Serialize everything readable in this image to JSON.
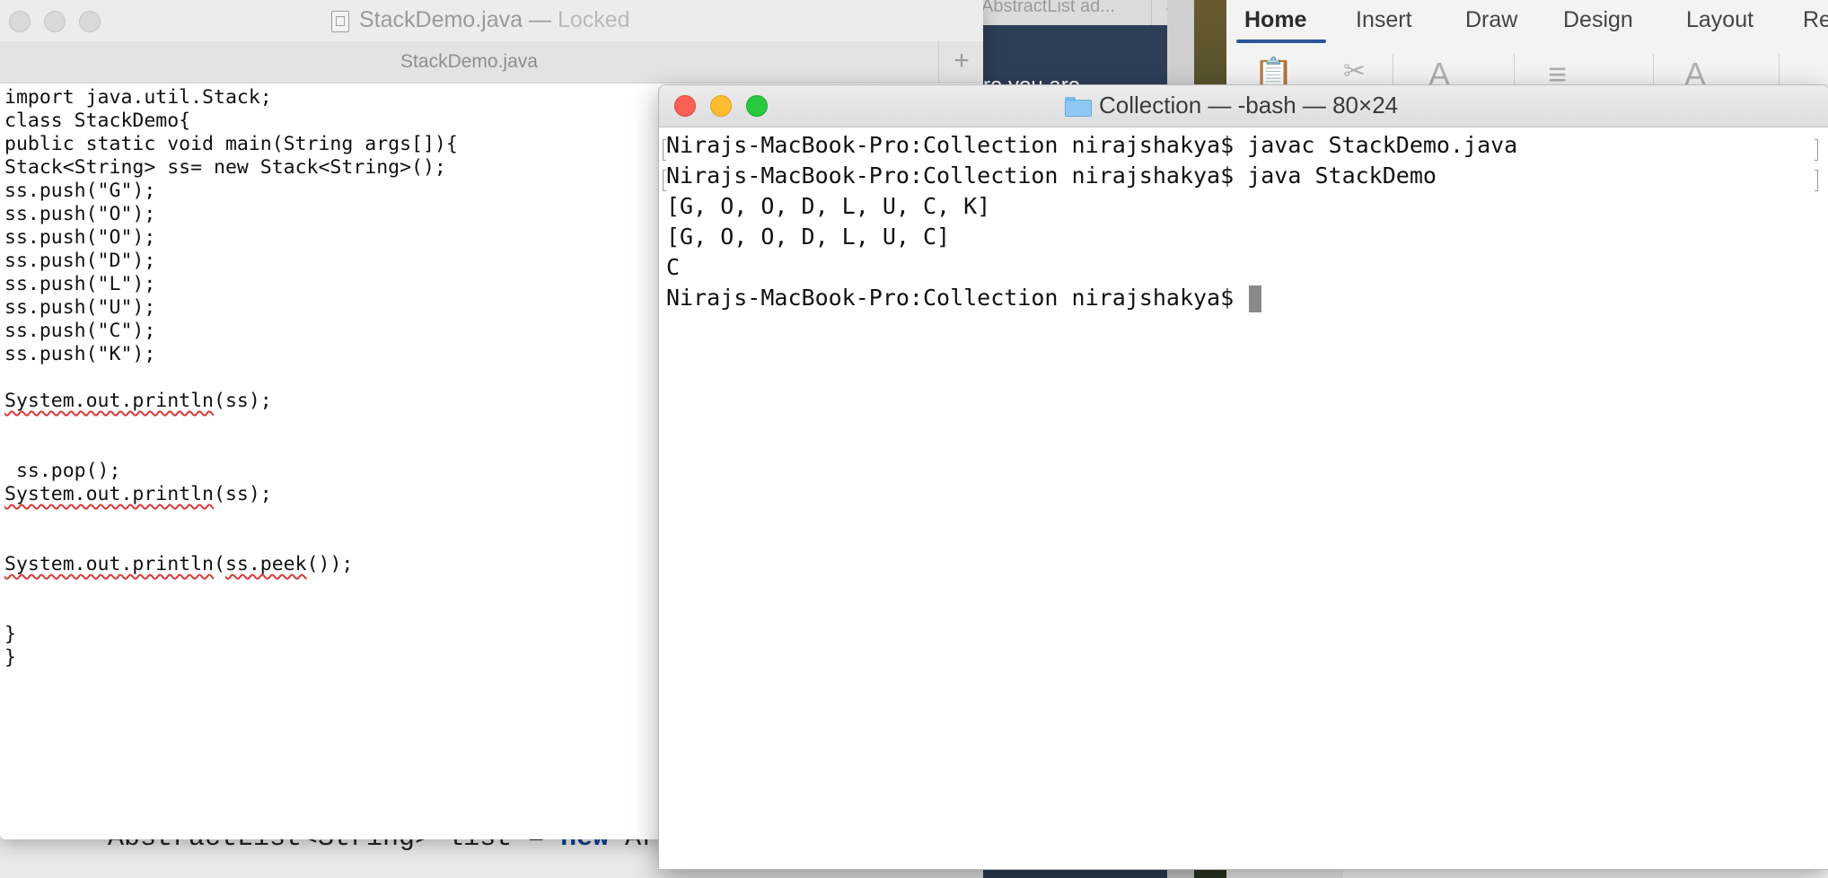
{
  "background": {
    "prev_tab_label": "AbstractList ad...",
    "prev_tab_plus": "+",
    "dark_strip_text": "re you are",
    "bottom_code_prefix": "AbstractList<String> list = ",
    "bottom_code_keyword": "new",
    "bottom_code_suffix": " Ar"
  },
  "word": {
    "tabs": [
      "Home",
      "Insert",
      "Draw",
      "Design",
      "Layout",
      "Re"
    ],
    "active_tab": "Home",
    "accent_color": "#2b579a"
  },
  "textedit": {
    "window_title": "StackDemo.java",
    "title_separator": " — ",
    "locked_label": "Locked",
    "tab_label": "StackDemo.java",
    "new_tab_label": "+",
    "code_lines": [
      "import java.util.Stack;",
      "class StackDemo{",
      "public static void main(String args[]){",
      "Stack<String> ss= new Stack<String>();",
      "ss.push(\"G\");",
      "ss.push(\"O\");",
      "ss.push(\"O\");",
      "ss.push(\"D\");",
      "ss.push(\"L\");",
      "ss.push(\"U\");",
      "ss.push(\"C\");",
      "ss.push(\"K\");",
      "",
      "System.out.println(ss);",
      "",
      "",
      " ss.pop();",
      "System.out.println(ss);",
      "",
      "",
      "System.out.println(ss.peek());",
      "",
      "",
      "}",
      "}"
    ]
  },
  "terminal": {
    "window_title": "Collection — -bash — 80×24",
    "lines": [
      "Nirajs-MacBook-Pro:Collection nirajshakya$ javac StackDemo.java",
      "Nirajs-MacBook-Pro:Collection nirajshakya$ java StackDemo",
      "[G, O, O, D, L, U, C, K]",
      "[G, O, O, D, L, U, C]",
      "C",
      "Nirajs-MacBook-Pro:Collection nirajshakya$ "
    ],
    "colors": {
      "close": "#fd5f57",
      "minimize": "#febc2e",
      "maximize": "#28c840"
    }
  }
}
